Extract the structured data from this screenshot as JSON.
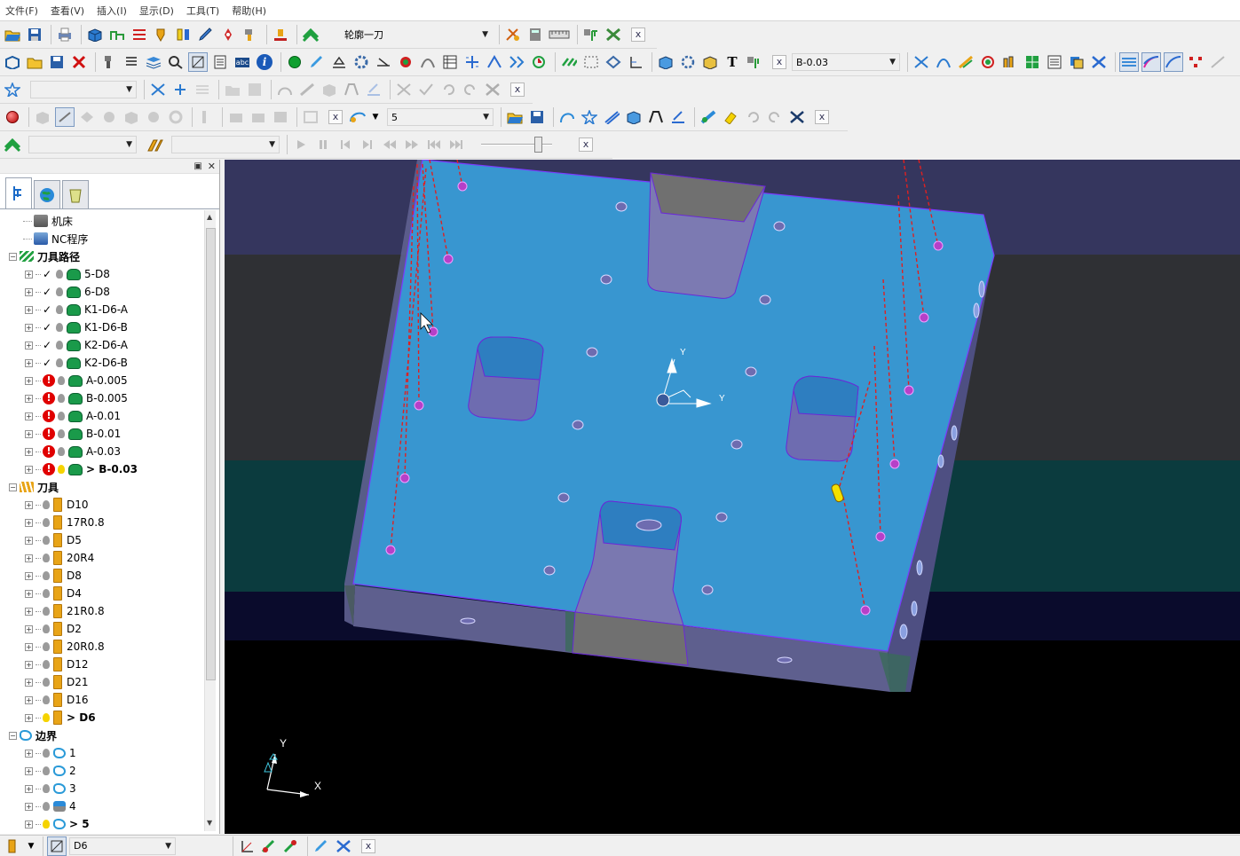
{
  "menu": [
    "文件(F)",
    "查看(V)",
    "插入(I)",
    "显示(D)",
    "工具(T)",
    "帮助(H)"
  ],
  "toolbar1": {
    "toolpath_combo": "轮廓一刀",
    "close": "x"
  },
  "toolbar2": {
    "toolpath_select": "B-0.03",
    "info_glyph": "i",
    "text_glyph": "T",
    "abc_glyph": "abc"
  },
  "toolbar4": {
    "level_value": "5"
  },
  "explorer": {
    "tree": [
      {
        "label": "机床",
        "type": "root",
        "icon": "machine-icon"
      },
      {
        "label": "NC程序",
        "type": "root",
        "icon": "nc-program-icon"
      },
      {
        "label": "刀具路径",
        "type": "folder",
        "icon": "toolpath-folder-icon"
      },
      {
        "label": "5-D8",
        "type": "toolpath",
        "status": "checked",
        "active": false
      },
      {
        "label": "6-D8",
        "type": "toolpath",
        "status": "checked",
        "active": false
      },
      {
        "label": "K1-D6-A",
        "type": "toolpath",
        "status": "checked",
        "active": false
      },
      {
        "label": "K1-D6-B",
        "type": "toolpath",
        "status": "checked",
        "active": false
      },
      {
        "label": "K2-D6-A",
        "type": "toolpath",
        "status": "checked",
        "active": false
      },
      {
        "label": "K2-D6-B",
        "type": "toolpath",
        "status": "checked",
        "active": false
      },
      {
        "label": "A-0.005",
        "type": "toolpath",
        "status": "warning",
        "active": false
      },
      {
        "label": "B-0.005",
        "type": "toolpath",
        "status": "warning",
        "active": false
      },
      {
        "label": "A-0.01",
        "type": "toolpath",
        "status": "warning",
        "active": false
      },
      {
        "label": "B-0.01",
        "type": "toolpath",
        "status": "warning",
        "active": false
      },
      {
        "label": "A-0.03",
        "type": "toolpath",
        "status": "warning",
        "active": false
      },
      {
        "label": "> B-0.03",
        "type": "toolpath",
        "status": "warning",
        "active": true
      },
      {
        "label": "刀具",
        "type": "folder",
        "icon": "tool-folder-icon"
      },
      {
        "label": "D10",
        "type": "tool",
        "active": false
      },
      {
        "label": "17R0.8",
        "type": "tool",
        "active": false
      },
      {
        "label": "D5",
        "type": "tool",
        "active": false
      },
      {
        "label": "20R4",
        "type": "tool",
        "active": false
      },
      {
        "label": "D8",
        "type": "tool",
        "active": false
      },
      {
        "label": "D4",
        "type": "tool",
        "active": false
      },
      {
        "label": "21R0.8",
        "type": "tool",
        "active": false
      },
      {
        "label": "D2",
        "type": "tool",
        "active": false
      },
      {
        "label": "20R0.8",
        "type": "tool",
        "active": false
      },
      {
        "label": "D12",
        "type": "tool",
        "active": false
      },
      {
        "label": "D21",
        "type": "tool",
        "active": false
      },
      {
        "label": "D16",
        "type": "tool",
        "active": false
      },
      {
        "label": "> D6",
        "type": "tool",
        "active": true
      },
      {
        "label": "边界",
        "type": "folder",
        "icon": "boundary-folder-icon"
      },
      {
        "label": "1",
        "type": "boundary",
        "active": false
      },
      {
        "label": "2",
        "type": "boundary",
        "active": false
      },
      {
        "label": "3",
        "type": "boundary",
        "active": false
      },
      {
        "label": "4",
        "type": "boundary",
        "active": false
      },
      {
        "label": "> 5",
        "type": "boundary",
        "active": true
      }
    ]
  },
  "viewport": {
    "axis_y": "Y",
    "axis_x": "X",
    "center_y": "Y",
    "center_x": "Y"
  },
  "status": {
    "tool_select": "D6"
  },
  "colors": {
    "viewport_bg_top": "#35365e",
    "viewport_bg_mid": "#2f3034",
    "viewport_bg_teal": "#0b3b3e",
    "viewport_bg_low": "#0a0b2c",
    "part_top": "#3896d0",
    "part_side": "#5e5f8e",
    "toolpath_link": "#e02020",
    "plunge_point": "#b640c8"
  }
}
